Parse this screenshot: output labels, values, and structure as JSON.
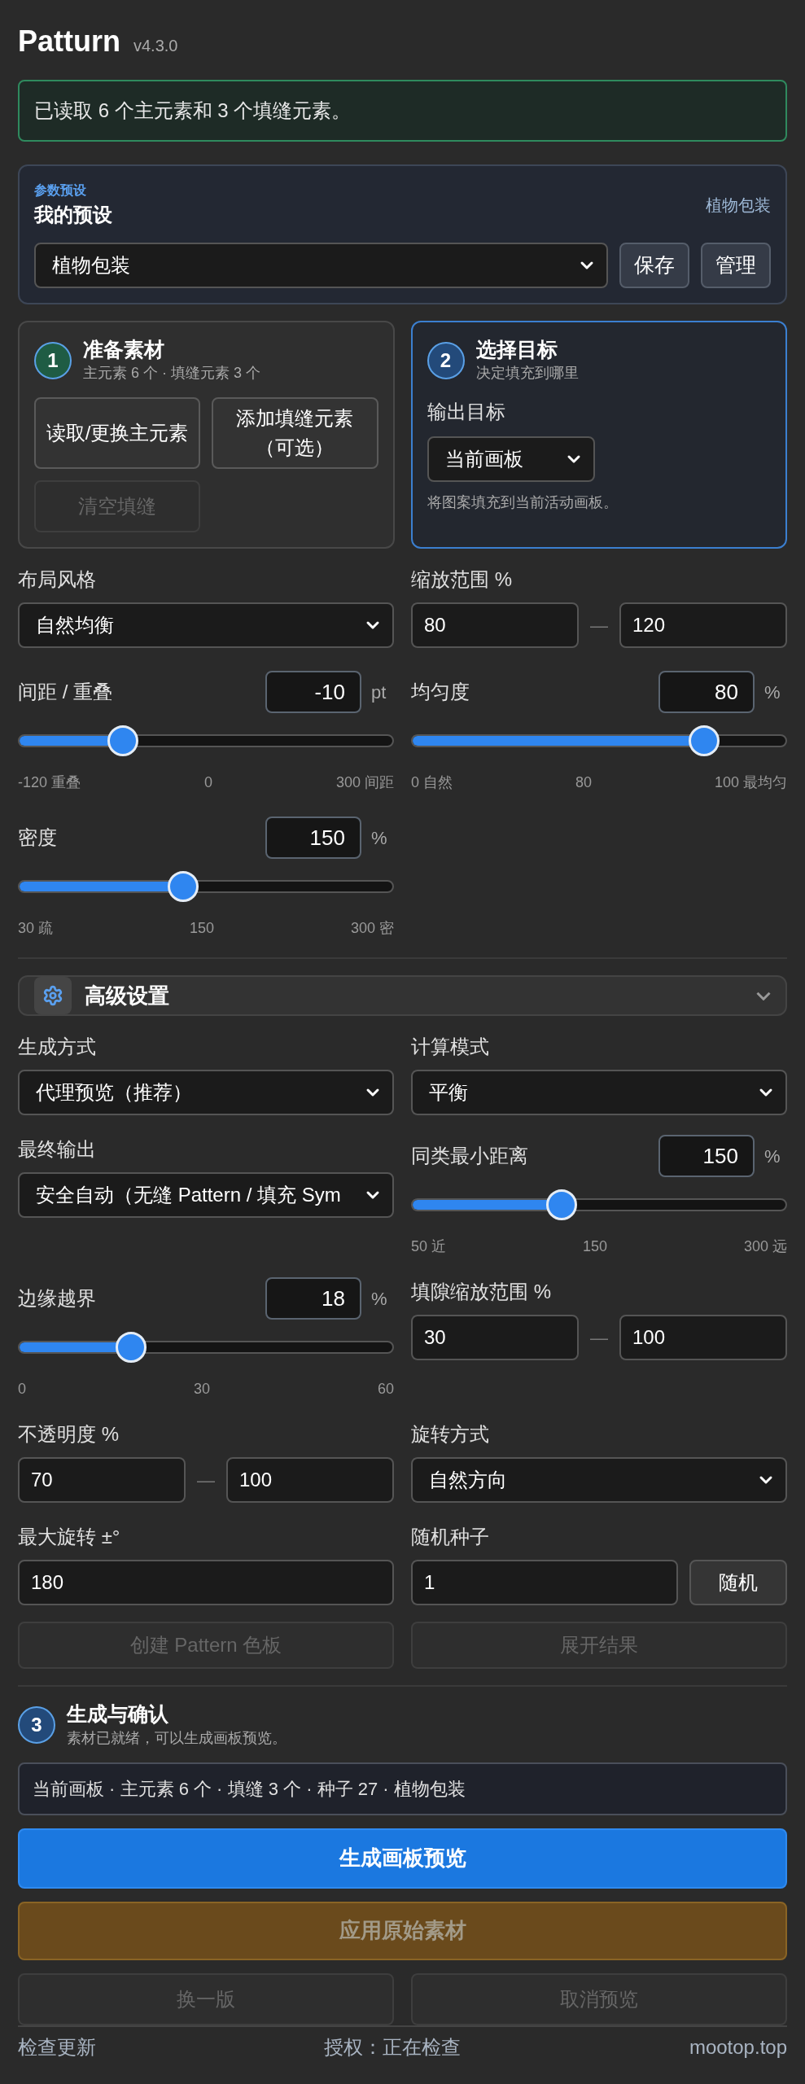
{
  "header": {
    "title": "Patturn",
    "version": "v4.3.0"
  },
  "status_message": "已读取 6 个主元素和 3 个填缝元素。",
  "preset": {
    "eyebrow": "参数预设",
    "title": "我的预设",
    "current_name": "植物包装",
    "select_value": "植物包装",
    "buttons": [
      "保存",
      "管理"
    ]
  },
  "steps": [
    {
      "number": "1",
      "title": "准备素材",
      "subtitle": "主元素 6 个 · 填缝元素 3 个",
      "color": "#1f5c44",
      "active": false,
      "kind": "materials",
      "buttons": [
        {
          "label": "读取/更换主元素",
          "disabled": false
        },
        {
          "label": "添加填缝元素（可选）",
          "disabled": false
        },
        {
          "label": "清空填缝",
          "disabled": true
        }
      ]
    },
    {
      "number": "2",
      "title": "选择目标",
      "subtitle": "决定填充到哪里",
      "color": "#234a7a",
      "active": true,
      "kind": "target",
      "field_label": "输出目标",
      "select_value": "当前画板",
      "hint": "将图案填充到当前活动画板。"
    }
  ],
  "basic_settings": [
    {
      "kind": "select",
      "label": "布局风格",
      "value": "自然均衡"
    },
    {
      "kind": "range",
      "label": "缩放范围 %",
      "min": "80",
      "separator": "—",
      "max": "120"
    },
    {
      "kind": "slider",
      "label": "间距 / 重叠",
      "value": "-10",
      "unit": "pt",
      "level": 0.28,
      "ticks": [
        "-120 重叠",
        "0",
        "300 间距"
      ]
    },
    {
      "kind": "slider",
      "label": "均匀度",
      "value": "80",
      "unit": "%",
      "level": 0.78,
      "ticks": [
        "0 自然",
        "80",
        "100 最均匀"
      ]
    },
    {
      "kind": "slider",
      "label": "密度",
      "value": "150",
      "unit": "%",
      "level": 0.44,
      "ticks": [
        "30 疏",
        "150",
        "300 密"
      ]
    }
  ],
  "advanced": {
    "title": "高级设置",
    "expanded": true,
    "controls": [
      {
        "kind": "select",
        "label": "生成方式",
        "value": "代理预览（推荐）"
      },
      {
        "kind": "select",
        "label": "计算模式",
        "value": "平衡"
      },
      {
        "kind": "select",
        "label": "最终输出",
        "value": "安全自动（无缝 Pattern / 填充 Sym"
      },
      {
        "kind": "slider",
        "label": "同类最小距离",
        "value": "150",
        "unit": "%",
        "level": 0.4,
        "ticks": [
          "50 近",
          "150",
          "300 远"
        ]
      },
      {
        "kind": "slider",
        "label": "边缘越界",
        "value": "18",
        "unit": "%",
        "level": 0.3,
        "ticks": [
          "0",
          "30",
          "60"
        ]
      },
      {
        "kind": "range",
        "label": "填隙缩放范围 %",
        "min": "30",
        "separator": "—",
        "max": "100"
      },
      {
        "kind": "range",
        "label": "不透明度 %",
        "min": "70",
        "separator": "—",
        "max": "100"
      },
      {
        "kind": "select",
        "label": "旋转方式",
        "value": "自然方向"
      },
      {
        "kind": "input",
        "label": "最大旋转 ±°",
        "value": "180"
      },
      {
        "kind": "input_button",
        "label": "随机种子",
        "value": "1",
        "button": "随机"
      }
    ],
    "buttons": [
      {
        "label": "创建 Pattern 色板",
        "disabled": true
      },
      {
        "label": "展开结果",
        "disabled": true
      }
    ]
  },
  "step3": {
    "number": "3",
    "title": "生成与确认",
    "subtitle": "素材已就绪，可以生成画板预览。",
    "color": "#234a7a",
    "summary": "当前画板 · 主元素 6 个 · 填缝 3 个 · 种子 27 · 植物包装",
    "primary": {
      "label": "生成画板预览",
      "disabled": false
    },
    "apply": {
      "label": "应用原始素材",
      "disabled": true
    },
    "buttons": [
      {
        "label": "换一版",
        "disabled": true
      },
      {
        "label": "取消预览",
        "disabled": true
      }
    ]
  },
  "footer": {
    "left": "检查更新",
    "center": "授权：正在检查",
    "right": "mootop.top"
  }
}
